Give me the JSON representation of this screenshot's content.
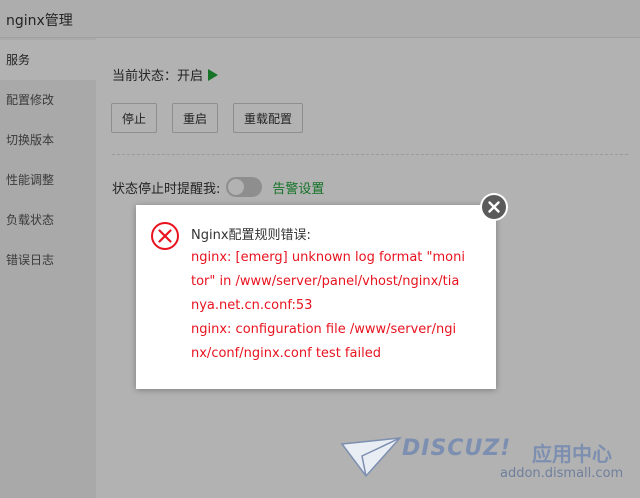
{
  "window": {
    "title": "nginx管理"
  },
  "sidebar": {
    "items": [
      {
        "label": "服务",
        "active": true
      },
      {
        "label": "配置修改",
        "active": false
      },
      {
        "label": "切换版本",
        "active": false
      },
      {
        "label": "性能调整",
        "active": false
      },
      {
        "label": "负载状态",
        "active": false
      },
      {
        "label": "错误日志",
        "active": false
      }
    ]
  },
  "main": {
    "status_label": "当前状态：",
    "status_value": "开启",
    "buttons": {
      "stop": "停止",
      "restart": "重启",
      "reload": "重载配置"
    },
    "remind_label": "状态停止时提醒我:",
    "remind_toggle_on": false,
    "alarm_link": "告警设置"
  },
  "dialog": {
    "heading": "Nginx配置规则错误:",
    "lines": [
      "nginx: [emerg] unknown log format \"moni",
      "tor\" in /www/server/panel/vhost/nginx/tia",
      "nya.net.cn.conf:53",
      "nginx: configuration file /www/server/ngi",
      "nx/conf/nginx.conf test failed"
    ]
  },
  "watermark": {
    "brand": "DISCUZ!",
    "brand_cn": "应用中心",
    "domain": "addon.dismall.com"
  },
  "colors": {
    "accent_green": "#20a53a",
    "error_red": "#e8131f",
    "watermark": "#7d8fb0"
  },
  "icons": {
    "status": "play-icon",
    "dialog": "error-circle-icon",
    "close": "close-icon",
    "watermark": "paper-plane-icon"
  }
}
